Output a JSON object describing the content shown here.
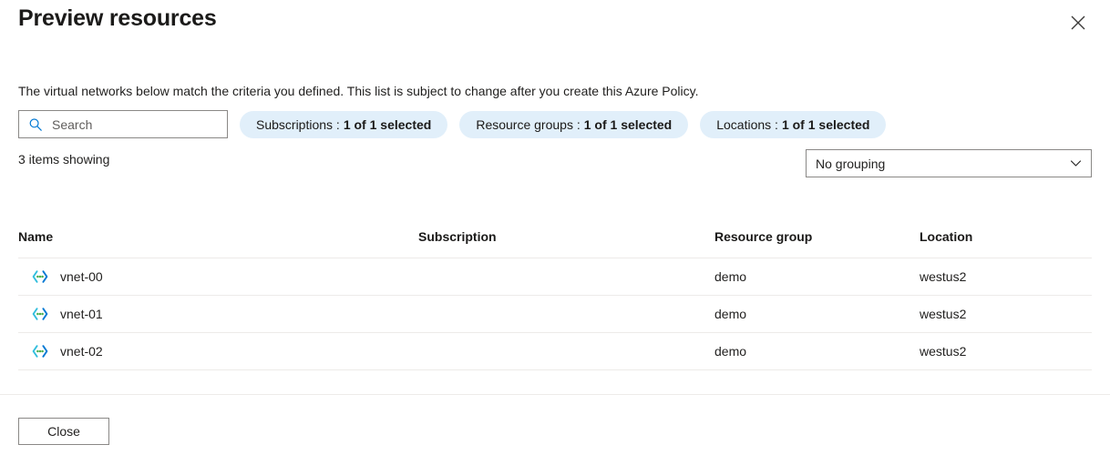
{
  "header": {
    "title": "Preview resources",
    "close_icon": "close-icon"
  },
  "description": "The virtual networks below match the criteria you defined. This list is subject to change after you create this Azure Policy.",
  "search": {
    "placeholder": "Search",
    "value": "",
    "icon": "search-icon"
  },
  "filters": [
    {
      "label": "Subscriptions :",
      "value": "1 of 1 selected"
    },
    {
      "label": "Resource groups :",
      "value": "1 of 1 selected"
    },
    {
      "label": "Locations :",
      "value": "1 of 1 selected"
    }
  ],
  "items_count": "3 items showing",
  "grouping": {
    "selected": "No grouping",
    "chevron_icon": "chevron-down-icon"
  },
  "table": {
    "columns": [
      "Name",
      "Subscription",
      "Resource group",
      "Location"
    ],
    "rows": [
      {
        "icon": "virtual-network-icon",
        "name": "vnet-00",
        "subscription": "",
        "resource_group": "demo",
        "location": "westus2"
      },
      {
        "icon": "virtual-network-icon",
        "name": "vnet-01",
        "subscription": "",
        "resource_group": "demo",
        "location": "westus2"
      },
      {
        "icon": "virtual-network-icon",
        "name": "vnet-02",
        "subscription": "",
        "resource_group": "demo",
        "location": "westus2"
      }
    ]
  },
  "footer": {
    "close_label": "Close"
  },
  "colors": {
    "pill_background": "#e1effa",
    "accent": "#0078d4",
    "text": "#201f1e",
    "divider": "#edebe9",
    "icon_arrow_left": "#32bedd",
    "icon_arrow_right": "#0078d4",
    "icon_dots": "#4caf50"
  }
}
